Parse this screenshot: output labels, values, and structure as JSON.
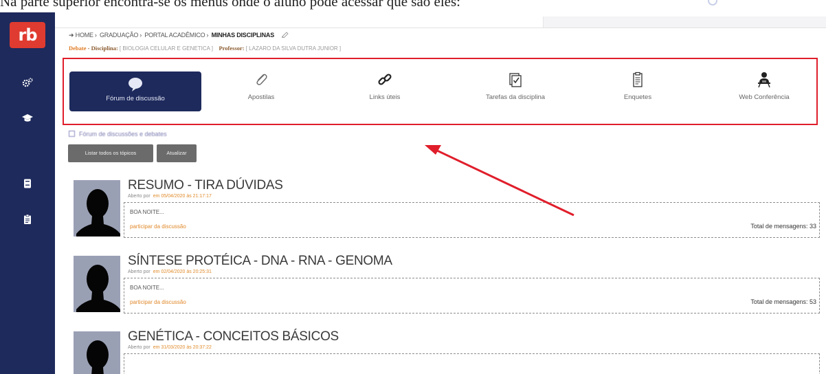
{
  "document": {
    "caption": "Na parte superior encontra-se os menus onde o aluno pode acessar que são eles:"
  },
  "sidebar": {
    "logo": "rb",
    "icons": [
      "gears-icon",
      "graduation-cap-icon",
      "book-icon",
      "clipboard-icon"
    ]
  },
  "breadcrumb": {
    "items": [
      "HOME",
      "GRADUAÇÃO",
      "PORTAL ACADÊMICO"
    ],
    "current": "MINHAS DISCIPLINAS",
    "separator": "›"
  },
  "context": {
    "section_label": "Debate",
    "discipline_label": "Disciplina:",
    "discipline_value": "[ BIOLOGIA CELULAR E GENETICA ]",
    "professor_label": "Professor:",
    "professor_value": "[ LAZARO DA SILVA DUTRA JUNIOR ]"
  },
  "tabs": [
    {
      "label": "Fórum de discussão",
      "icon": "speech-bubble-icon",
      "active": true
    },
    {
      "label": "Apostilas",
      "icon": "paperclip-icon",
      "active": false
    },
    {
      "label": "Links úteis",
      "icon": "link-icon",
      "active": false
    },
    {
      "label": "Tarefas da disciplina",
      "icon": "tasks-icon",
      "active": false
    },
    {
      "label": "Enquetes",
      "icon": "clipboard-list-icon",
      "active": false
    },
    {
      "label": "Web Conferência",
      "icon": "presenter-icon",
      "active": false
    }
  ],
  "section": {
    "title": "Fórum de discussões e debates"
  },
  "actions": {
    "list_all": "Listar todos os tópicos",
    "refresh": "Atualizar"
  },
  "topics": [
    {
      "title": "RESUMO - TIRA DÚVIDAS",
      "opened_by": "Aberto por",
      "date": "em 05/04/2020 às 21:17:17",
      "preview": "BOA NOITE...",
      "link": "participar da discussão",
      "total": "Total de mensagens: 33"
    },
    {
      "title": "SÍNTESE PROTÉICA - DNA - RNA - GENOMA",
      "opened_by": "Aberto por",
      "date": "em 02/04/2020 às 20:25:31",
      "preview": "BOA NOITE...",
      "link": "participar da discussão",
      "total": "Total de mensagens: 53"
    },
    {
      "title": "GENÉTICA - CONCEITOS BÁSICOS",
      "opened_by": "Aberto por",
      "date": "em 31/03/2020 às 20:37:22",
      "preview": "",
      "link": "",
      "total": ""
    }
  ],
  "colors": {
    "sidebar": "#1e2a5c",
    "logo": "#e03b30",
    "highlight": "#e01e2b",
    "accent_orange": "#e0882a"
  }
}
